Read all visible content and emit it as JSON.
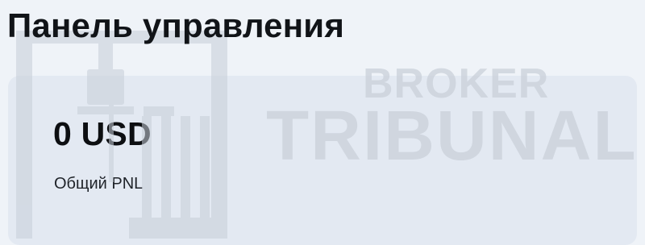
{
  "header": {
    "title": "Панель управления"
  },
  "summary_card": {
    "value": "0 USD",
    "label": "Общий PNL"
  },
  "watermark": {
    "line1": "BROKER",
    "line2": "TRIBUNAL",
    "icon": "gavel-icon"
  },
  "colors": {
    "background": "#eff3f8",
    "card": "#e3e9f2",
    "text": "#111418",
    "watermark": "#c9d0d9"
  }
}
